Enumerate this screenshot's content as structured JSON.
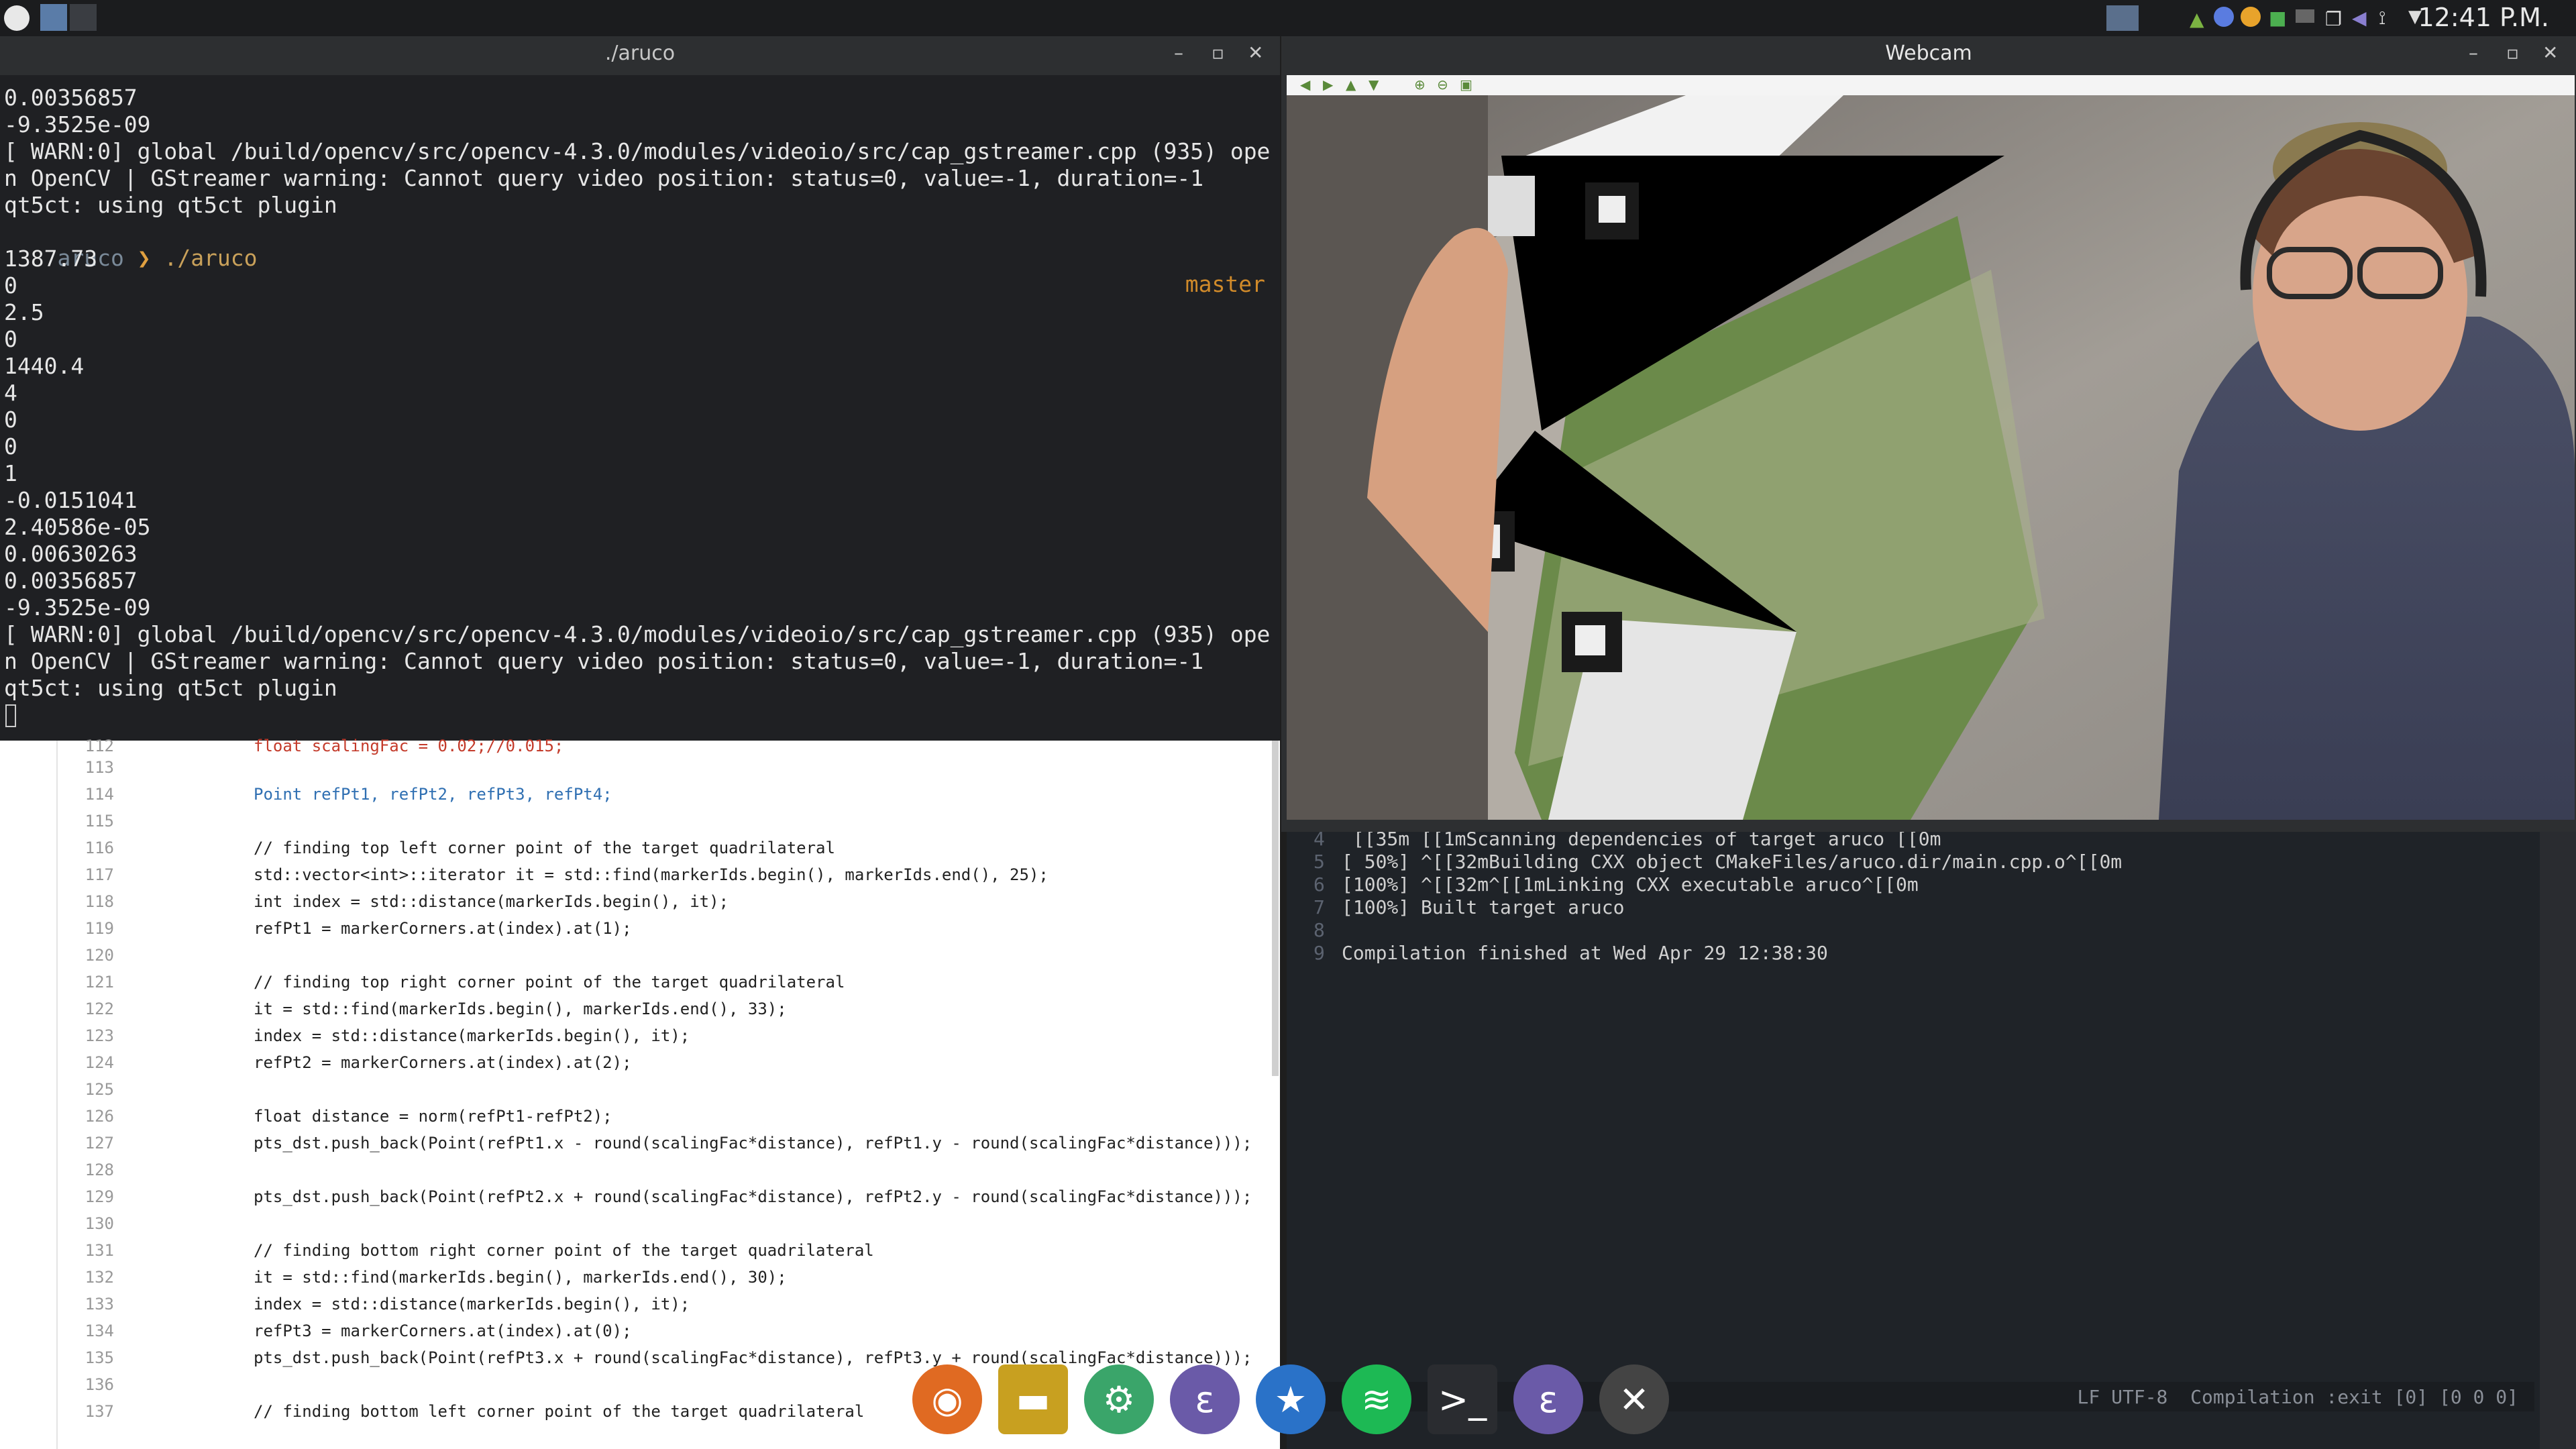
{
  "topbar": {
    "clock": "12:41 P.M."
  },
  "terminal": {
    "title": "./aruco",
    "lines": [
      "0.00356857",
      "-9.3525e-09",
      "[ WARN:0] global /build/opencv/src/opencv-4.3.0/modules/videoio/src/cap_gstreamer.cpp (935) ope",
      "n OpenCV | GStreamer warning: Cannot query video position: status=0, value=-1, duration=-1",
      "qt5ct: using qt5ct plugin",
      "",
      "1387.73",
      "0",
      "2.5",
      "0",
      "1440.4",
      "4",
      "0",
      "0",
      "1",
      "-0.0151041",
      "2.40586e-05",
      "0.00630263",
      "0.00356857",
      "-9.3525e-09",
      "[ WARN:0] global /build/opencv/src/opencv-4.3.0/modules/videoio/src/cap_gstreamer.cpp (935) ope",
      "n OpenCV | GStreamer warning: Cannot query video position: status=0, value=-1, duration=-1",
      "qt5ct: using qt5ct plugin"
    ],
    "prompt_dir": "aruco",
    "prompt_arrow": "❯",
    "prompt_cmd": "./aruco",
    "prompt_branch": "master"
  },
  "editor": {
    "line_numbers": [
      "112",
      "113",
      "114",
      "115",
      "116",
      "117",
      "118",
      "119",
      "120",
      "121",
      "122",
      "123",
      "124",
      "125",
      "126",
      "127",
      "128",
      "129",
      "130",
      "131",
      "132",
      "133",
      "134",
      "135",
      "136",
      "137"
    ],
    "first_line_partial": "float scalingFac = 0.02;//0.015;",
    "line_114": "Point refPt1, refPt2, refPt3, refPt4;",
    "line_116": "// finding top left corner point of the target quadrilateral",
    "line_117": "std::vector<int>::iterator it = std::find(markerIds.begin(), markerIds.end(), 25);",
    "line_118": "int index = std::distance(markerIds.begin(), it);",
    "line_119": "refPt1 = markerCorners.at(index).at(1);",
    "line_121": "// finding top right corner point of the target quadrilateral",
    "line_122": "it = std::find(markerIds.begin(), markerIds.end(), 33);",
    "line_123": "index = std::distance(markerIds.begin(), it);",
    "line_124": "refPt2 = markerCorners.at(index).at(2);",
    "line_126": "float distance = norm(refPt1-refPt2);",
    "line_127": "pts_dst.push_back(Point(refPt1.x - round(scalingFac*distance), refPt1.y - round(scalingFac*distance)));",
    "line_129": "pts_dst.push_back(Point(refPt2.x + round(scalingFac*distance), refPt2.y - round(scalingFac*distance)));",
    "line_131": "// finding bottom right corner point of the target quadrilateral",
    "line_132": "it = std::find(markerIds.begin(), markerIds.end(), 30);",
    "line_133": "index = std::distance(markerIds.begin(), it);",
    "line_134": "refPt3 = markerCorners.at(index).at(0);",
    "line_135": "pts_dst.push_back(Point(refPt3.x + round(scalingFac*distance), refPt3.y + round(scalingFac*distance)));",
    "line_137": "// finding bottom left corner point of the target quadrilateral"
  },
  "webcam": {
    "title": "Webcam"
  },
  "emacs": {
    "rows": [
      {
        "n": "4",
        "text": " [[35m [[1mScanning dependencies of target aruco [[0m"
      },
      {
        "n": "5",
        "text": "[ 50%] ^[[32mBuilding CXX object CMakeFiles/aruco.dir/main.cpp.o^[[0m"
      },
      {
        "n": "6",
        "text": "[100%] ^[[32m^[[1mLinking CXX executable aruco^[[0m"
      },
      {
        "n": "7",
        "text": "[100%] Built target aruco"
      },
      {
        "n": "8",
        "text": ""
      },
      {
        "n": "9",
        "text": "Compilation finished at Wed Apr 29 12:38:30"
      }
    ],
    "modeline": "LF UTF-8  Compilation :exit [0] [0 0 0]"
  },
  "dock": {
    "icons": [
      "firefox-icon",
      "files-icon",
      "settings-icon",
      "emacs-icon",
      "kstars-icon",
      "spotify-icon",
      "terminal-icon",
      "emacs-icon",
      "x-icon"
    ]
  }
}
